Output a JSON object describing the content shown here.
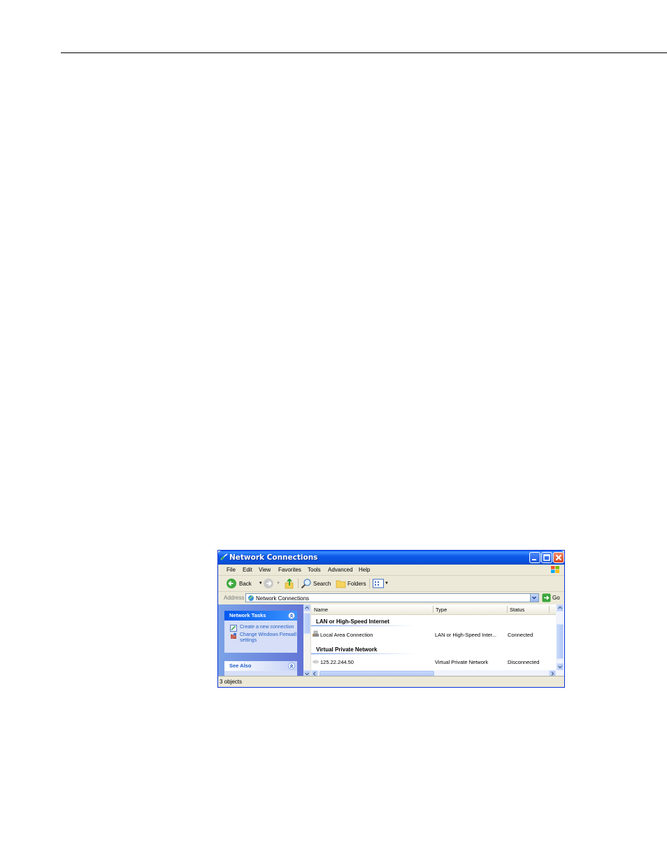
{
  "window": {
    "title": "Network Connections",
    "title_color": "#0a5ff0"
  },
  "menu": {
    "file": "File",
    "edit": "Edit",
    "view": "View",
    "favorites": "Favorites",
    "tools": "Tools",
    "advanced": "Advanced",
    "help": "Help"
  },
  "toolbar": {
    "back": "Back",
    "search": "Search",
    "folders": "Folders"
  },
  "address": {
    "label": "Address",
    "value": "Network Connections",
    "go": "Go"
  },
  "tasks": {
    "network_tasks_title": "Network Tasks",
    "create_connection": "Create a new connection",
    "firewall_settings": "Change Windows Firewall settings",
    "see_also_title": "See Also"
  },
  "list": {
    "columns": {
      "name": "Name",
      "type": "Type",
      "status": "Status"
    },
    "groups": [
      {
        "title": "LAN or High-Speed Internet",
        "items": [
          {
            "name": "Local Area Connection",
            "type": "LAN or High-Speed Inter...",
            "status": "Connected"
          }
        ]
      },
      {
        "title": "Virtual Private Network",
        "items": [
          {
            "name": "125.22.244.50",
            "type": "Virtual Private Network",
            "status": "Disconnected"
          }
        ]
      }
    ]
  },
  "status_bar": {
    "text": "3 objects"
  }
}
